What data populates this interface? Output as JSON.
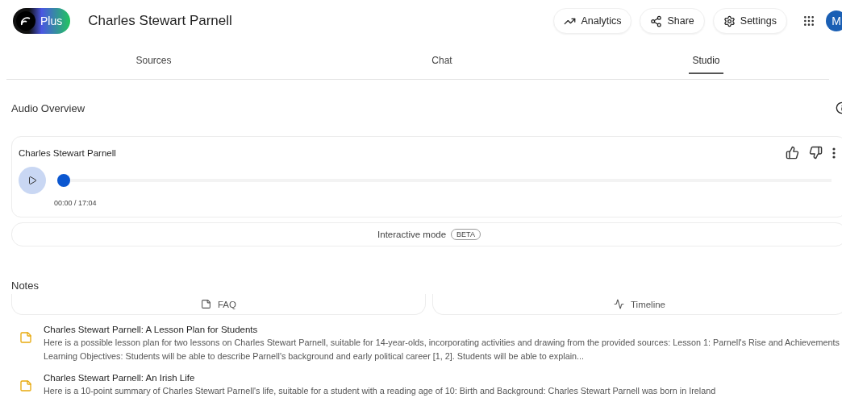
{
  "header": {
    "badge": "Plus",
    "title": "Charles Stewart Parnell",
    "buttons": [
      {
        "kind": "analytics",
        "label": "Analytics"
      },
      {
        "kind": "share",
        "label": "Share"
      },
      {
        "kind": "settings",
        "label": "Settings"
      }
    ],
    "avatar": "M"
  },
  "tabs": [
    {
      "label": "Sources",
      "selected": false
    },
    {
      "label": "Chat",
      "selected": false
    },
    {
      "label": "Studio",
      "selected": true
    }
  ],
  "audio_overview": {
    "heading": "Audio Overview",
    "title": "Charles Stewart Parnell",
    "level": 0,
    "time": "00:00 / 17:04",
    "interactive": {
      "label": "Interactive mode",
      "badge": "BETA"
    }
  },
  "notes": {
    "heading": "Notes",
    "buttons": [
      {
        "kind": "faq",
        "label": "FAQ"
      },
      {
        "kind": "timeline",
        "label": "Timeline"
      }
    ],
    "items": [
      {
        "title": "Charles Stewart Parnell: A Lesson Plan for Students",
        "body": "Here is a possible lesson plan for two lessons on Charles Stewart Parnell, suitable for 14-year-olds, incorporating activities and drawing from the provided sources: Lesson 1: Parnell's Rise and Achievements Learning Objectives: Students will be able to describe Parnell's background and early political career [1, 2]. Students will be able to explain..."
      },
      {
        "title": "Charles Stewart Parnell: An Irish Life",
        "body": "Here is a 10-point summary of Charles Stewart Parnell's life, suitable for a student with a reading age of 10: Birth and Background: Charles Stewart Parnell was born in Ireland"
      }
    ]
  }
}
